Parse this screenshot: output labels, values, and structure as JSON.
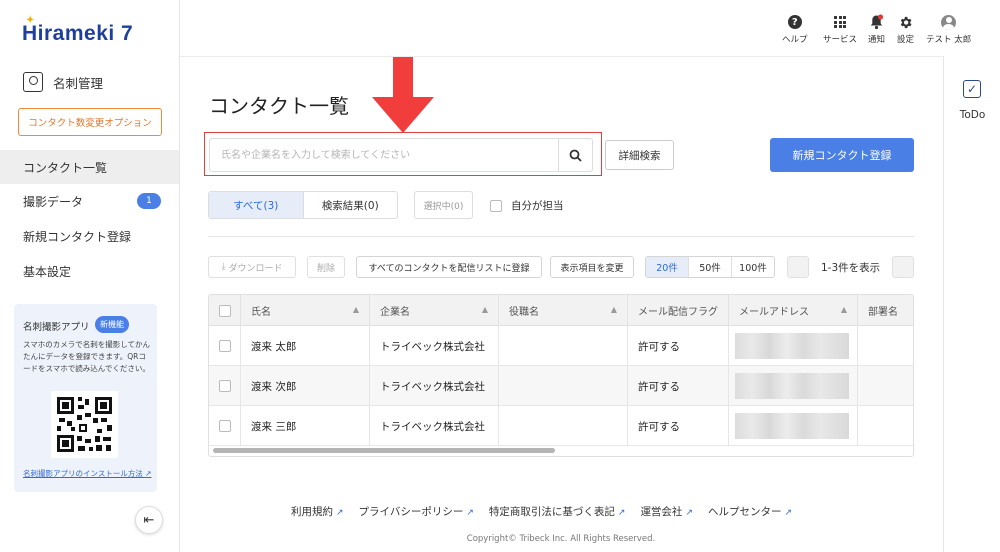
{
  "brand": {
    "logo_text": "Hirameki 7"
  },
  "sidebar": {
    "section_title": "名刺管理",
    "option_button": "コンタクト数変更オプション",
    "items": [
      {
        "label": "コンタクト一覧",
        "active": true
      },
      {
        "label": "撮影データ",
        "badge": "1"
      },
      {
        "label": "新規コンタクト登録"
      },
      {
        "label": "基本設定"
      }
    ],
    "app_promo": {
      "title": "名刺撮影アプリ",
      "badge": "新機能",
      "description": "スマホのカメラで名刺を撮影してかんたんにデータを登録できます。QRコードをスマホで読み込んでください。",
      "link": "名刺撮影アプリのインストール方法"
    }
  },
  "header": {
    "items": [
      {
        "label": "ヘルプ",
        "icon": "help-icon"
      },
      {
        "label": "サービス",
        "icon": "grid-icon"
      },
      {
        "label": "通知",
        "icon": "bell-icon"
      },
      {
        "label": "設定",
        "icon": "gear-icon"
      },
      {
        "label": "テスト 太郎",
        "icon": "user-icon"
      }
    ]
  },
  "todo": {
    "label": "ToDo"
  },
  "main": {
    "title": "コンタクト一覧",
    "search_placeholder": "氏名や企業名を入力して検索してください",
    "search_value": "",
    "advanced_search": "詳細検索",
    "new_contact": "新規コンタクト登録",
    "tabs": [
      {
        "label": "すべて(3)",
        "active": true
      },
      {
        "label": "検索結果(0)",
        "active": false
      }
    ],
    "selected_button": "選択中(0)",
    "mine_checkbox": "自分が担当",
    "toolbar": {
      "download": "ダウンロード",
      "delete": "削除",
      "register_all": "すべてのコンタクトを配信リストに登録",
      "change_columns": "表示項目を変更",
      "per_page": [
        "20件",
        "50件",
        "100件"
      ],
      "per_page_selected": "20件",
      "page_info": "1-3件を表示"
    },
    "table": {
      "columns": [
        "氏名",
        "企業名",
        "役職名",
        "メール配信フラグ",
        "メールアドレス",
        "部署名"
      ],
      "rows": [
        {
          "name": "渡来 太郎",
          "company": "トライベック株式会社",
          "title": "",
          "mail_flag": "許可する"
        },
        {
          "name": "渡来 次郎",
          "company": "トライベック株式会社",
          "title": "",
          "mail_flag": "許可する"
        },
        {
          "name": "渡来 三郎",
          "company": "トライベック株式会社",
          "title": "",
          "mail_flag": "許可する"
        }
      ]
    }
  },
  "footer": {
    "links": [
      "利用規約",
      "プライバシーポリシー",
      "特定商取引法に基づく表記",
      "運営会社",
      "ヘルプセンター"
    ],
    "copyright": "Copyright© Tribeck Inc. All Rights Reserved."
  },
  "colors": {
    "accent": "#4a7fe6",
    "option_orange": "#f08a3a",
    "highlight_red": "#e04040",
    "arrow_red": "#f23d3d"
  }
}
